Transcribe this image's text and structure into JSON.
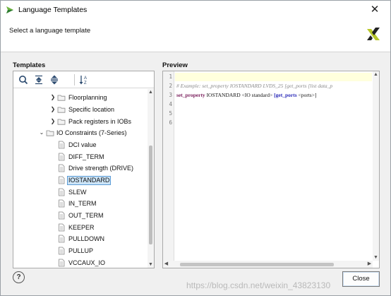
{
  "window": {
    "title": "Language Templates",
    "close_glyph": "✕"
  },
  "header": {
    "subtitle": "Select a language template",
    "logo_icon": "xilinx-logo-icon"
  },
  "templates": {
    "section_label": "Templates",
    "toolbar": {
      "buttons": [
        "search-icon",
        "collapse-all-icon",
        "expand-all-icon",
        "sort-icon"
      ]
    },
    "tree": [
      {
        "label": "Floorplanning",
        "kind": "folder",
        "expanded": false
      },
      {
        "label": "Specific location",
        "kind": "folder",
        "expanded": false
      },
      {
        "label": "Pack registers in IOBs",
        "kind": "folder",
        "expanded": false
      },
      {
        "label": "IO Constraints (7-Series)",
        "kind": "folder",
        "expanded": true
      },
      {
        "label": "DCI value",
        "kind": "file"
      },
      {
        "label": "DIFF_TERM",
        "kind": "file"
      },
      {
        "label": "Drive strength (DRIVE)",
        "kind": "file"
      },
      {
        "label": "IOSTANDARD",
        "kind": "file",
        "selected": true
      },
      {
        "label": "SLEW",
        "kind": "file"
      },
      {
        "label": "IN_TERM",
        "kind": "file"
      },
      {
        "label": "OUT_TERM",
        "kind": "file"
      },
      {
        "label": "KEEPER",
        "kind": "file"
      },
      {
        "label": "PULLDOWN",
        "kind": "file"
      },
      {
        "label": "PULLUP",
        "kind": "file"
      },
      {
        "label": "VCCAUX_IO",
        "kind": "file"
      }
    ]
  },
  "preview": {
    "section_label": "Preview",
    "line_numbers": [
      "1",
      "2",
      "3",
      "4",
      "5",
      "6"
    ],
    "line2_comment": "# Example: set_property IOSTANDARD LVDS_25 [get_ports [list data_p",
    "line3": {
      "kw1": "set_property",
      "mid": " IOSTANDARD <IO standard> ",
      "kw2": "[get_ports",
      "end": " <ports>]"
    }
  },
  "footer": {
    "help_label": "?",
    "close_label": "Close",
    "watermark": "https://blog.csdn.net/weixin_43823130"
  },
  "colors": {
    "selection_bg": "#cce4f7",
    "keyword_purple": "#7a1f5c",
    "keyword_blue": "#2a2ab8",
    "comment_gray": "#8a8a8a"
  }
}
